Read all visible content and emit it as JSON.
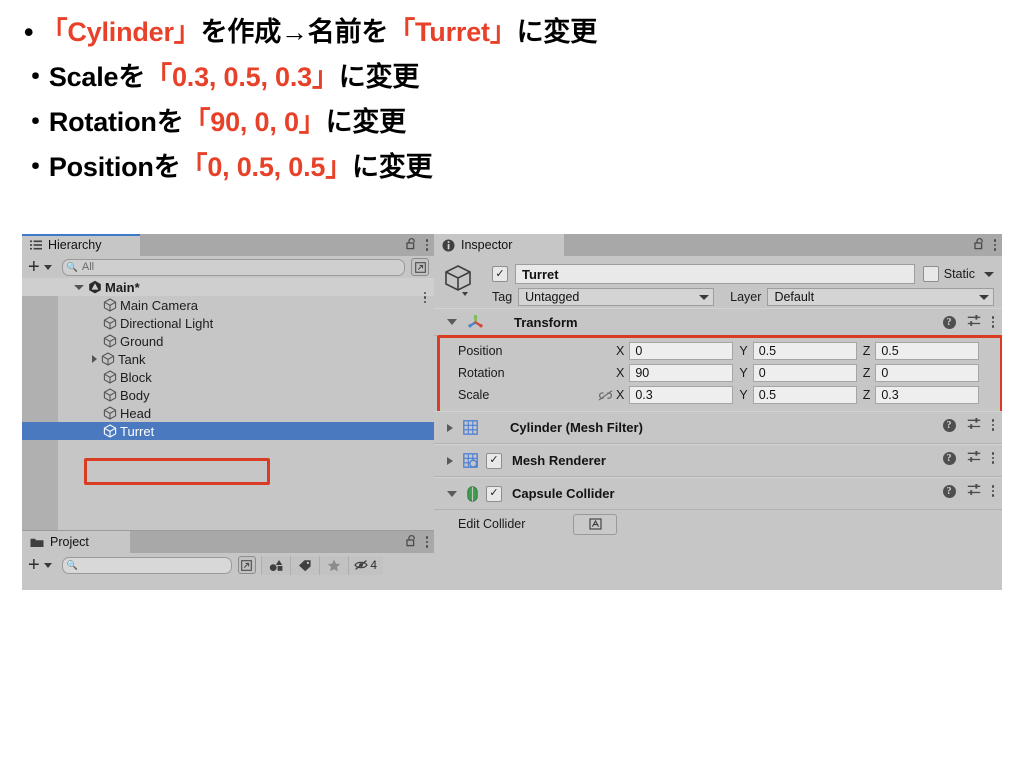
{
  "slide": {
    "bullets": [
      {
        "marker": "・",
        "parts": [
          {
            "t": "「Cylinder」",
            "hl": true
          },
          {
            "t": "を作成→名前を",
            "hl": false
          },
          {
            "t": "「Turret」",
            "hl": true
          },
          {
            "t": "に変更",
            "hl": false
          }
        ]
      },
      {
        "marker": "・",
        "parts": [
          {
            "t": "Scaleを",
            "hl": false
          },
          {
            "t": "「0.3, 0.5, 0.3」",
            "hl": true
          },
          {
            "t": "に変更",
            "hl": false
          }
        ]
      },
      {
        "marker": "・",
        "parts": [
          {
            "t": "Rotationを",
            "hl": false
          },
          {
            "t": "「90, 0, 0」",
            "hl": true
          },
          {
            "t": "に変更",
            "hl": false
          }
        ]
      },
      {
        "marker": "・",
        "parts": [
          {
            "t": "Positionを",
            "hl": false
          },
          {
            "t": "「0, 0.5, 0.5」",
            "hl": true
          },
          {
            "t": "に変更",
            "hl": false
          }
        ]
      }
    ],
    "highlight_color": "#e8412a",
    "text_color": "#000000"
  },
  "hierarchy": {
    "tab_label": "Hierarchy",
    "tab_icon": "list-icon",
    "lock_icon": "lock-open-icon",
    "menu_icon": "kebab-menu-icon",
    "add_label": "+",
    "search": {
      "value": "All",
      "placeholder": "All",
      "icon": "search-icon"
    },
    "expand_icon": "expand-window-icon",
    "items": [
      {
        "label": "Main*",
        "indent": 0,
        "arrow": "down",
        "icon": "unity-scene-icon",
        "selected": false,
        "bold": true
      },
      {
        "label": "Main Camera",
        "indent": 1,
        "arrow": "none",
        "icon": "gameobject-cube-icon",
        "selected": false,
        "bold": false
      },
      {
        "label": "Directional Light",
        "indent": 1,
        "arrow": "none",
        "icon": "gameobject-cube-icon",
        "selected": false,
        "bold": false
      },
      {
        "label": "Ground",
        "indent": 1,
        "arrow": "none",
        "icon": "gameobject-cube-icon",
        "selected": false,
        "bold": false
      },
      {
        "label": "Tank",
        "indent": 1,
        "arrow": "right",
        "icon": "gameobject-cube-icon",
        "selected": false,
        "bold": false
      },
      {
        "label": "Block",
        "indent": 1,
        "arrow": "none",
        "icon": "gameobject-cube-icon",
        "selected": false,
        "bold": false
      },
      {
        "label": "Body",
        "indent": 1,
        "arrow": "none",
        "icon": "gameobject-cube-icon",
        "selected": false,
        "bold": false
      },
      {
        "label": "Head",
        "indent": 1,
        "arrow": "none",
        "icon": "gameobject-cube-icon",
        "selected": false,
        "bold": false
      },
      {
        "label": "Turret",
        "indent": 1,
        "arrow": "none",
        "icon": "gameobject-cube-icon",
        "selected": true,
        "bold": false
      }
    ],
    "selection_color": "#4a79bf",
    "annotation_color": "#d93c23"
  },
  "project": {
    "tab_label": "Project",
    "tab_icon": "folder-icon",
    "lock_icon": "lock-open-icon",
    "menu_icon": "kebab-menu-icon",
    "add_label": "+",
    "search": {
      "value": "",
      "placeholder": "",
      "icon": "search-icon"
    },
    "expand_icon": "expand-window-icon",
    "filter_buttons": [
      {
        "name": "filter-by-type-icon"
      },
      {
        "name": "filter-by-label-icon"
      },
      {
        "name": "favorites-star-icon"
      },
      {
        "name": "hidden-packages-icon",
        "count": "4"
      }
    ]
  },
  "inspector": {
    "tab_label": "Inspector",
    "tab_icon": "info-icon",
    "lock_icon": "lock-open-icon",
    "menu_icon": "kebab-menu-icon",
    "object_icon": "gameobject-cube-icon",
    "enabled_checkbox": {
      "checked": true,
      "mark": "✓"
    },
    "name": "Turret",
    "static": {
      "label": "Static",
      "checked": false
    },
    "tag": {
      "label": "Tag",
      "value": "Untagged"
    },
    "layer": {
      "label": "Layer",
      "value": "Default"
    },
    "transform": {
      "title": "Transform",
      "icon": "transform-axis-icon",
      "expanded": true,
      "help_icon": "help-icon",
      "preset_icon": "preset-sliders-icon",
      "menu_icon": "kebab-menu-icon",
      "constrain_icon": "constrain-proportions-off-icon",
      "rows": [
        {
          "label": "Position",
          "x": "0",
          "y": "0.5",
          "z": "0.5",
          "link": false
        },
        {
          "label": "Rotation",
          "x": "90",
          "y": "0",
          "z": "0",
          "link": false
        },
        {
          "label": "Scale",
          "x": "0.3",
          "y": "0.5",
          "z": "0.3",
          "link": true
        }
      ],
      "axis_labels": [
        "X",
        "Y",
        "Z"
      ]
    },
    "components": [
      {
        "title": "Cylinder (Mesh Filter)",
        "icon": "mesh-filter-icon",
        "expanded": false,
        "has_checkbox": false,
        "checked": false,
        "help_icon": "help-icon",
        "preset_icon": "preset-sliders-icon",
        "menu_icon": "kebab-menu-icon"
      },
      {
        "title": "Mesh Renderer",
        "icon": "mesh-renderer-icon",
        "expanded": false,
        "has_checkbox": true,
        "checked": true,
        "help_icon": "help-icon",
        "preset_icon": "preset-sliders-icon",
        "menu_icon": "kebab-menu-icon"
      },
      {
        "title": "Capsule Collider",
        "icon": "capsule-collider-icon",
        "expanded": true,
        "has_checkbox": true,
        "checked": true,
        "help_icon": "help-icon",
        "preset_icon": "preset-sliders-icon",
        "menu_icon": "kebab-menu-icon"
      }
    ],
    "capsule_collider": {
      "edit_collider_label": "Edit Collider",
      "edit_button_icon": "edit-collider-icon"
    }
  }
}
